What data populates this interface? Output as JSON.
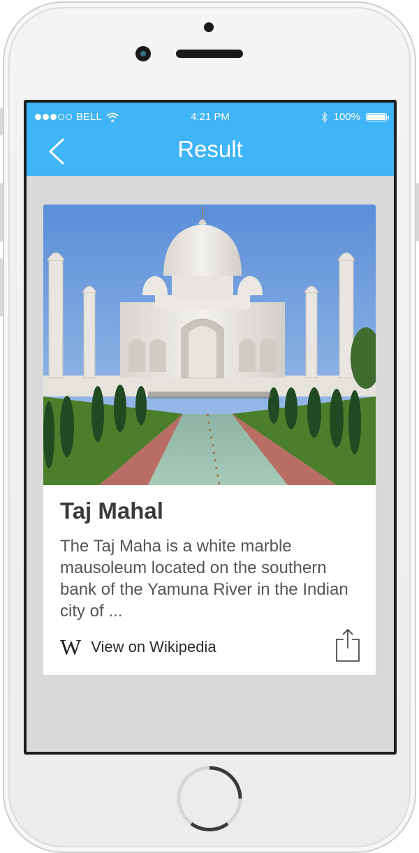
{
  "status_bar": {
    "carrier": "BELL",
    "time": "4:21 PM",
    "battery": "100%",
    "signal_icon": "signal-dots-icon",
    "wifi_icon": "wifi-icon",
    "bluetooth_icon": "bluetooth-icon",
    "battery_icon": "battery-icon"
  },
  "nav": {
    "title": "Result",
    "back_icon": "chevron-left-icon",
    "color": "#3fb4f7"
  },
  "card": {
    "image_alt": "Taj Mahal photo",
    "title": "Taj Mahal",
    "description": "The Taj Maha is a white marble mausoleum located on the southern bank of the Yamuna River in the Indian city of ...",
    "wiki_logo": "W",
    "wiki_link": "View on Wikipedia",
    "share_icon": "share-icon"
  }
}
